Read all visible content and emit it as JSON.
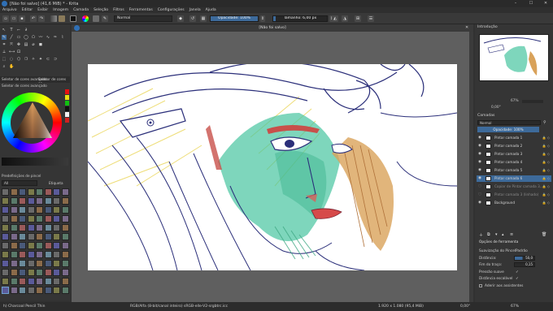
{
  "window": {
    "title": "[Não foi salvo] (41,6 MiB) * - Krita",
    "controls": [
      "–",
      "☐",
      "✕"
    ]
  },
  "menu": [
    "Arquivo",
    "Editar",
    "Exibir",
    "Imagem",
    "Camada",
    "Seleção",
    "Filtros",
    "Ferramentas",
    "Configurações",
    "Janela",
    "Ajuda"
  ],
  "toolbar": {
    "blend_mode": "Normal",
    "opacity_label": "Opacidade: 100%",
    "opacity": 1.0,
    "size_label": "Tamanho: 6,00 px"
  },
  "document": {
    "tab_title": "[Não foi salvo]"
  },
  "left": {
    "docker_tabs": [
      "Seletor de cores avançado",
      "Seletor de cores es..."
    ],
    "color_title": "Seletor de cores avançado",
    "preset_title": "Predefinições de pincel",
    "preset_filter": "All",
    "preset_tag": "Etiqueta"
  },
  "right": {
    "overview_title": "Introdução",
    "zoom_value": "67%",
    "rotation_value": "0,00°",
    "layers_title": "Camadas",
    "layers_blend": "Normal",
    "layers_opacity": "Opacidade: 100%",
    "layers": [
      {
        "name": "Pintar camada 1",
        "visible": true,
        "selected": false
      },
      {
        "name": "Pintar camada 2",
        "visible": true,
        "selected": false
      },
      {
        "name": "Pintar camada 3",
        "visible": true,
        "selected": false
      },
      {
        "name": "Pintar camada 4",
        "visible": true,
        "selected": false
      },
      {
        "name": "Pintar camada 5",
        "visible": true,
        "selected": false
      },
      {
        "name": "Pintar camada 6",
        "visible": true,
        "selected": true
      },
      {
        "name": "Copiar de Pintar camada 3...",
        "visible": false,
        "selected": false
      },
      {
        "name": "Pintar camada 3 (linhado)",
        "visible": false,
        "selected": false
      },
      {
        "name": "Background",
        "visible": true,
        "selected": false
      }
    ],
    "tool_options_title": "Opções de ferramenta",
    "smoothing_label": "Suavização do Pincel:",
    "smoothing_value": "Padrão",
    "distance_label": "Distância:",
    "distance_value": "50,0",
    "stroke_end_label": "Fim do traço:",
    "stroke_end_value": "0,15",
    "smooth_pressure_label": "Pressão suave",
    "scalable_distance_label": "Distância escalável",
    "assistants_label": "Aderir aos assistentes"
  },
  "status": {
    "brush": "h) Charcoal Pencil Thin",
    "color_info": "RGB/Alfa (8-bit/canal inteiro) sRGB-elle-V2-srgbtrc.icc",
    "dims": "1.920 x 1.080 (95,4 MiB)",
    "rotation": "0,00°",
    "zoom": "67%"
  },
  "colors": {
    "accent": "#3d6a9a",
    "canvas_bg": "#5f5f5f",
    "panel_bg": "#353535"
  }
}
